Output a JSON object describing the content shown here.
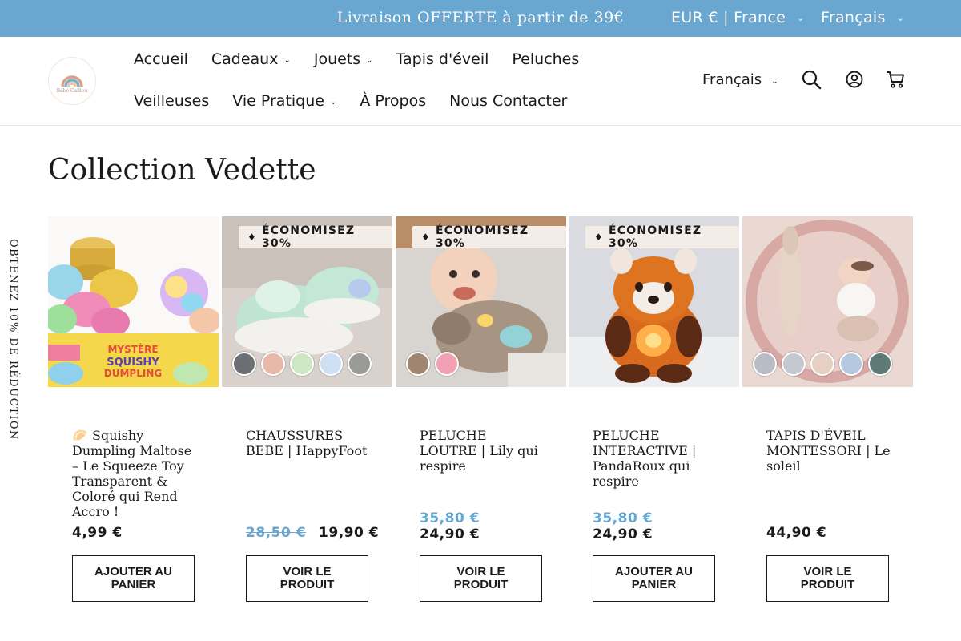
{
  "announcement": {
    "promo": "Livraison OFFERTE à partir de 39€",
    "currency_region": "EUR € | France",
    "language": "Français"
  },
  "header": {
    "logo_text": "Bébé Caillou",
    "nav_row1": [
      {
        "label": "Accueil",
        "dropdown": false
      },
      {
        "label": "Cadeaux",
        "dropdown": true
      },
      {
        "label": "Jouets",
        "dropdown": true
      },
      {
        "label": "Tapis d'éveil",
        "dropdown": false
      },
      {
        "label": "Peluches",
        "dropdown": false
      }
    ],
    "nav_row2": [
      {
        "label": "Veilleuses",
        "dropdown": false
      },
      {
        "label": "Vie Pratique",
        "dropdown": true
      },
      {
        "label": "À Propos",
        "dropdown": false
      },
      {
        "label": "Nous Contacter",
        "dropdown": false
      }
    ],
    "language": "Français",
    "icons": [
      "search-icon",
      "account-icon",
      "cart-icon"
    ]
  },
  "side_tab": "OBTENEZ 10% DE RÉDUCTION",
  "section_title": "Collection Vedette",
  "products": [
    {
      "name": "🥟 Squishy Dumpling Maltose – Le Squeeze Toy Transparent & Coloré qui Rend Accro !",
      "badge": "",
      "old_price": "",
      "price": "4,99 €",
      "button": "AJOUTER AU PANIER",
      "image_text": "MYSTÈRE SQUISHY DUMPLING",
      "swatch_colors": []
    },
    {
      "name": "CHAUSSURES BEBE | HappyFoot",
      "badge": "ÉCONOMISEZ 30%",
      "old_price": "28,50 €",
      "price": "19,90 €",
      "button": "VOIR LE PRODUIT",
      "image_text": "",
      "swatch_colors": [
        "#6b6f74",
        "#e8b8a8",
        "#cfe6c4",
        "#cfe0f4",
        "#9a9a98"
      ]
    },
    {
      "name": "PELUCHE LOUTRE | Lily qui respire",
      "badge": "ÉCONOMISEZ 30%",
      "old_price": "35,80 €",
      "price": "24,90 €",
      "button": "VOIR LE PRODUIT",
      "image_text": "",
      "swatch_colors": [
        "#a08670",
        "#f2a0b4"
      ]
    },
    {
      "name": "PELUCHE INTERACTIVE | PandaRoux qui respire",
      "badge": "ÉCONOMISEZ 30%",
      "old_price": "35,80 €",
      "price": "24,90 €",
      "button": "AJOUTER AU PANIER",
      "image_text": "",
      "swatch_colors": []
    },
    {
      "name": "TAPIS D'ÉVEIL MONTESSORI | Le soleil",
      "badge": "",
      "old_price": "",
      "price": "44,90 €",
      "button": "VOIR LE PRODUIT",
      "image_text": "",
      "swatch_colors": [
        "#b8bcc4",
        "#c4c8d0",
        "#e6d0c4",
        "#b4c8e0",
        "#5e7a78"
      ]
    }
  ],
  "colors": {
    "announcement_bg": "#6aa7d0",
    "old_price": "#6aa7d0",
    "badge_bg": "#f4ece6",
    "text": "#1a1a1a"
  }
}
